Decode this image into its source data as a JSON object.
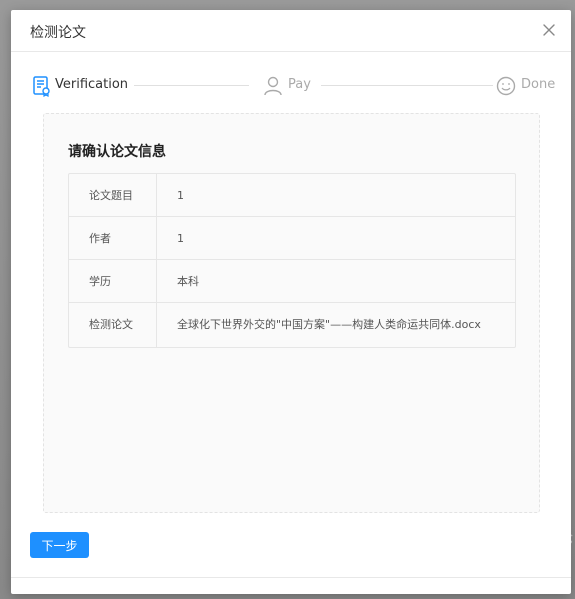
{
  "dialog": {
    "title": "检测论文"
  },
  "steps": [
    {
      "label": "Verification",
      "state": "active",
      "icon": "document-check-icon"
    },
    {
      "label": "Pay",
      "state": "pending",
      "icon": "user-icon"
    },
    {
      "label": "Done",
      "state": "pending",
      "icon": "smile-icon"
    }
  ],
  "panel": {
    "heading": "请确认论文信息",
    "rows": [
      {
        "label": "论文题目",
        "value": "1"
      },
      {
        "label": "作者",
        "value": "1"
      },
      {
        "label": "学历",
        "value": "本科"
      },
      {
        "label": "检测论文",
        "value": "全球化下世界外交的\"中国方案\"——构建人类命运共同体.docx"
      }
    ]
  },
  "actions": {
    "next_label": "下一步"
  },
  "colors": {
    "accent": "#1e90ff",
    "active_step": "#1e90ff",
    "pending_step": "#aaaaaa"
  }
}
